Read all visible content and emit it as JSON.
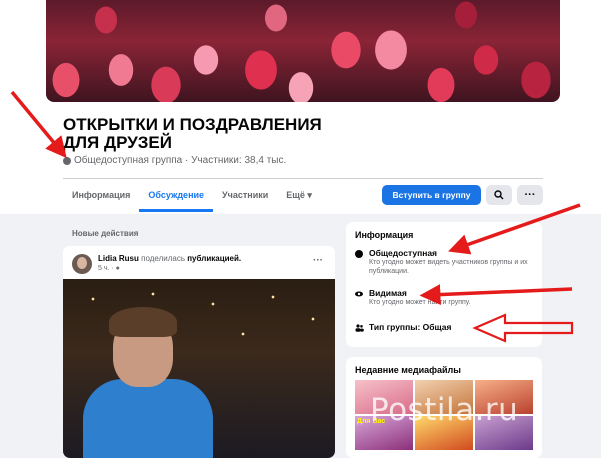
{
  "group": {
    "title": "ОТКРЫТКИ И ПОЗДРАВЛЕНИЯ ДЛЯ ДРУЗЕЙ",
    "meta": "Общедоступная группа · Участники: 38,4 тыс."
  },
  "tabs": [
    {
      "label": "Информация"
    },
    {
      "label": "Обсуждение"
    },
    {
      "label": "Участники"
    },
    {
      "label": "Ещё ▾"
    }
  ],
  "actions": {
    "join_label": "Вступить в группу",
    "search_icon": "search-icon",
    "more_label": "···"
  },
  "feed": {
    "recent_label": "Новые действия",
    "post": {
      "author": "Lidia Rusu",
      "action": " поделилась ",
      "object": "публикацией.",
      "time": "5 ч. · ",
      "more": "···"
    }
  },
  "info": {
    "title": "Информация",
    "items": [
      {
        "icon": "globe-icon",
        "label": "Общедоступная",
        "desc": "Кто угодно может видеть участников группы и их публикации."
      },
      {
        "icon": "eye-icon",
        "label": "Видимая",
        "desc": "Кто угодно может найти группу."
      },
      {
        "icon": "people-icon",
        "label": "Тип группы: Общая",
        "desc": ""
      }
    ]
  },
  "media": {
    "title": "Недавние медиафайлы",
    "tiles": [
      "",
      "",
      "",
      "Для Вас",
      "",
      ""
    ]
  },
  "watermark": "Postila.ru",
  "colors": {
    "accent": "#1877f2",
    "arrow": "#e51a1a"
  }
}
